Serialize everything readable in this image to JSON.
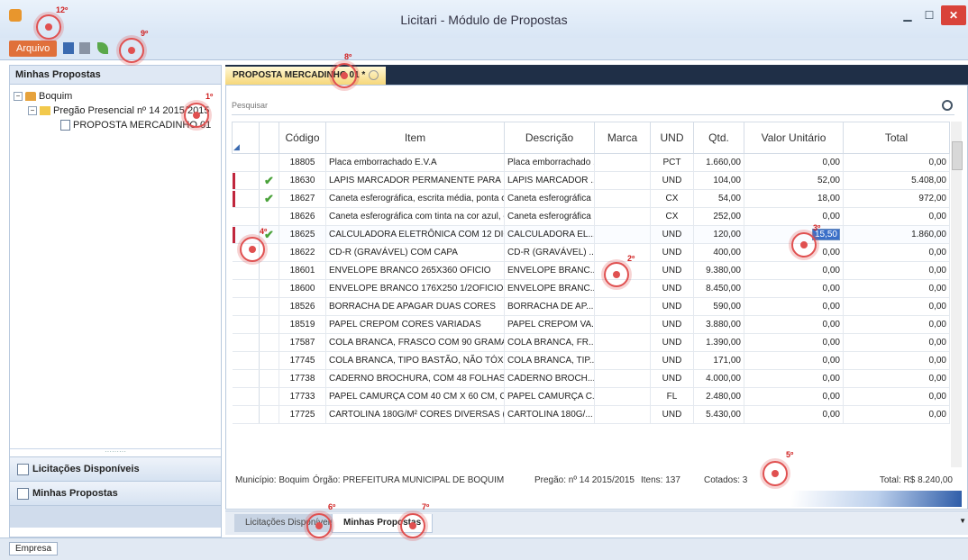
{
  "window": {
    "title": "Licitari - Módulo de Propostas"
  },
  "ribbon": {
    "arquivo_label": "Arquivo"
  },
  "left_panel": {
    "title": "Minhas Propostas",
    "tree": {
      "root": "Boquim",
      "child": "Pregão Presencial nº 14 2015/2015",
      "leaf": "PROPOSTA MERCADINHO 01"
    },
    "nav": [
      {
        "label": "Licitações Disponíveis"
      },
      {
        "label": "Minhas Propostas"
      }
    ]
  },
  "doc_tab": {
    "label": "PROPOSTA MERCADINHO 01 *"
  },
  "search": {
    "placeholder": "Pesquisar"
  },
  "table": {
    "columns": [
      "",
      "",
      "Código",
      "Item",
      "Descrição",
      "Marca",
      "UND",
      "Qtd.",
      "Valor Unitário",
      "Total"
    ],
    "rows": [
      {
        "check": "",
        "codigo": "18805",
        "item": "Placa emborrachado E.V.A",
        "descricao": "Placa emborrachado ...",
        "marca": "",
        "und": "PCT",
        "qtd": "1.660,00",
        "valor": "0,00",
        "total": "0,00"
      },
      {
        "check": "✔",
        "codigo": "18630",
        "item": "LAPIS MARCADOR PERMANENTE PARA ...",
        "descricao": "LAPIS MARCADOR ...",
        "marca": "",
        "und": "UND",
        "qtd": "104,00",
        "valor": "52,00",
        "total": "5.408,00"
      },
      {
        "check": "✔",
        "codigo": "18627",
        "item": "Caneta esferográfica, escrita média, ponta co...",
        "descricao": "Caneta esferográfica ...",
        "marca": "",
        "und": "CX",
        "qtd": "54,00",
        "valor": "18,00",
        "total": "972,00"
      },
      {
        "check": "",
        "codigo": "18626",
        "item": "Caneta esferográfica com tinta na cor azul, e...",
        "descricao": "Caneta esferográfica ...",
        "marca": "",
        "und": "CX",
        "qtd": "252,00",
        "valor": "0,00",
        "total": "0,00"
      },
      {
        "check": "✔",
        "codigo": "18625",
        "item": "CALCULADORA ELETRÔNICA COM 12 DIG...",
        "descricao": "CALCULADORA EL...",
        "marca": "",
        "und": "UND",
        "qtd": "120,00",
        "valor": "15,50",
        "total": "1.860,00"
      },
      {
        "check": "",
        "codigo": "18622",
        "item": "CD-R (GRAVÁVEL) COM CAPA",
        "descricao": "CD-R (GRAVÁVEL) ...",
        "marca": "",
        "und": "UND",
        "qtd": "400,00",
        "valor": "0,00",
        "total": "0,00"
      },
      {
        "check": "",
        "codigo": "18601",
        "item": "ENVELOPE BRANCO 265X360 OFICIO",
        "descricao": "ENVELOPE BRANC...",
        "marca": "",
        "und": "UND",
        "qtd": "9.380,00",
        "valor": "0,00",
        "total": "0,00"
      },
      {
        "check": "",
        "codigo": "18600",
        "item": "ENVELOPE BRANCO 176X250 1/2OFICIO",
        "descricao": "ENVELOPE BRANC...",
        "marca": "",
        "und": "UND",
        "qtd": "8.450,00",
        "valor": "0,00",
        "total": "0,00"
      },
      {
        "check": "",
        "codigo": "18526",
        "item": "BORRACHA DE APAGAR DUAS CORES",
        "descricao": "BORRACHA DE AP...",
        "marca": "",
        "und": "UND",
        "qtd": "590,00",
        "valor": "0,00",
        "total": "0,00"
      },
      {
        "check": "",
        "codigo": "18519",
        "item": "PAPEL CREPOM CORES VARIADAS",
        "descricao": "PAPEL CREPOM VA...",
        "marca": "",
        "und": "UND",
        "qtd": "3.880,00",
        "valor": "0,00",
        "total": "0,00"
      },
      {
        "check": "",
        "codigo": "17587",
        "item": "COLA BRANCA, FRASCO COM 90 GRAMAS",
        "descricao": "COLA BRANCA, FR...",
        "marca": "",
        "und": "UND",
        "qtd": "1.390,00",
        "valor": "0,00",
        "total": "0,00"
      },
      {
        "check": "",
        "codigo": "17745",
        "item": "COLA BRANCA, TIPO BASTÃO, NÃO TÓXI...",
        "descricao": "COLA BRANCA, TIP...",
        "marca": "",
        "und": "UND",
        "qtd": "171,00",
        "valor": "0,00",
        "total": "0,00"
      },
      {
        "check": "",
        "codigo": "17738",
        "item": "CADERNO BROCHURA, COM 48 FOLHAS...",
        "descricao": "CADERNO BROCH...",
        "marca": "",
        "und": "UND",
        "qtd": "4.000,00",
        "valor": "0,00",
        "total": "0,00"
      },
      {
        "check": "",
        "codigo": "17733",
        "item": "PAPEL CAMURÇA COM 40 CM X 60 CM, C...",
        "descricao": "PAPEL CAMURÇA C...",
        "marca": "",
        "und": "FL",
        "qtd": "2.480,00",
        "valor": "0,00",
        "total": "0,00"
      },
      {
        "check": "",
        "codigo": "17725",
        "item": "CARTOLINA 180G/M² CORES DIVERSAS (...",
        "descricao": "CARTOLINA 180G/...",
        "marca": "",
        "und": "UND",
        "qtd": "5.430,00",
        "valor": "0,00",
        "total": "0,00"
      }
    ]
  },
  "status": {
    "municipio": "Município: Boquim",
    "orgao": "Órgão: PREFEITURA MUNICIPAL DE BOQUIM",
    "pregao": "Pregão: nº 14 2015/2015",
    "itens": "Itens: 137",
    "cotados": "Cotados: 3",
    "total": "Total: R$ 8.240,00"
  },
  "bottom_tabs": [
    {
      "label": "Licitações Disponíveis"
    },
    {
      "label": "Minhas Propostas"
    }
  ],
  "statusbar": {
    "empresa": "Empresa"
  },
  "markers": [
    "1º",
    "2º",
    "3º",
    "4º",
    "5º",
    "6º",
    "7º",
    "8º",
    "9º",
    "12º"
  ],
  "colors": {
    "accent": "#e0703a",
    "check": "#4aa23a",
    "marker": "#e05050",
    "dark_tabbar": "#1f2f47"
  }
}
